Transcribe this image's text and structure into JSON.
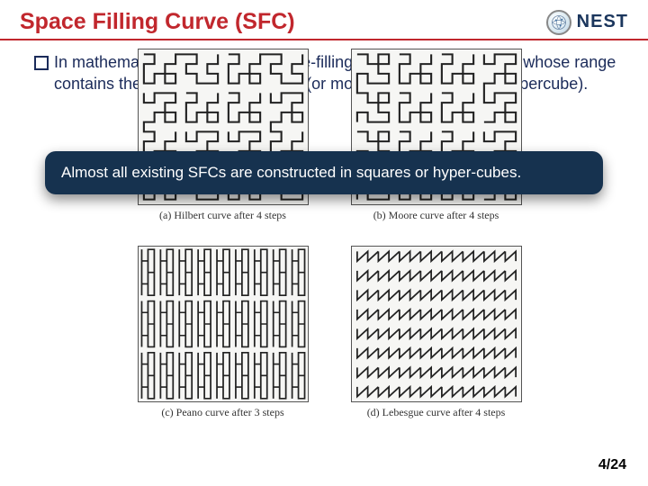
{
  "header": {
    "title": "Space Filling Curve (SFC)",
    "logo_text": "NEST"
  },
  "bullet_text": "In mathematical analysis, the space-filling curve refers to a curve whose range contains the entire 2-D unit square (or more generally the N-D hypercube).",
  "callout_text": "Almost all existing SFCs are constructed in squares or hyper-cubes.",
  "figures": {
    "a": "(a) Hilbert curve after 4 steps",
    "b": "(b) Moore curve after 4 steps",
    "c": "(c) Peano curve after 3 steps",
    "d": "(d) Lebesgue curve after 4 steps"
  },
  "page_number": "4/24"
}
